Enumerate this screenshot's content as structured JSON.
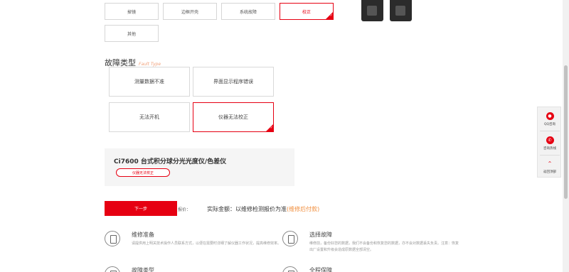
{
  "options": {
    "row1": [
      "掉镜",
      "边框开壳",
      "系统故障",
      "校正"
    ],
    "row2": [
      "其他"
    ],
    "selected": "校正"
  },
  "fault_section": {
    "title": "故障类型",
    "subtitle": "Fault Type",
    "items": [
      "测量数据不准",
      "界面显示程序错误",
      "无法开机",
      "仪器无法校正"
    ],
    "selected": "仪器无法校正"
  },
  "summary": {
    "product_name": "Ci7600 台式积分球分光光度仪/色差仪",
    "tag": "仪器无法校正"
  },
  "price": {
    "next_button": "下一步",
    "label": "报价：",
    "amount_text": "实际金额：以维修检测报价为准",
    "note": "(维修后付款)"
  },
  "info": [
    {
      "title": "维修准备",
      "desc": "请提供用上明关技术操作人员联系方式，以便在需要时详细了解仪器工作状况，提高维修效率。"
    },
    {
      "title": "选择故障",
      "desc": "维修前，备份好您的数据，我们不会备份和恢复您的数据，亦不会对数据丢失负责。注意：恢复出厂设置和升级会造成原数据全部清空。"
    },
    {
      "title": "故障类型",
      "desc": ""
    },
    {
      "title": "全程保障",
      "desc": ""
    }
  ],
  "float_bar": {
    "items": [
      {
        "label": "QQ咨询",
        "icon": "qq-icon"
      },
      {
        "label": "咨询热线",
        "icon": "phone-icon"
      },
      {
        "label": "返回顶部",
        "icon": "arrow-up-icon"
      }
    ]
  },
  "colors": {
    "accent": "#e60012",
    "note": "#f08c3a"
  }
}
